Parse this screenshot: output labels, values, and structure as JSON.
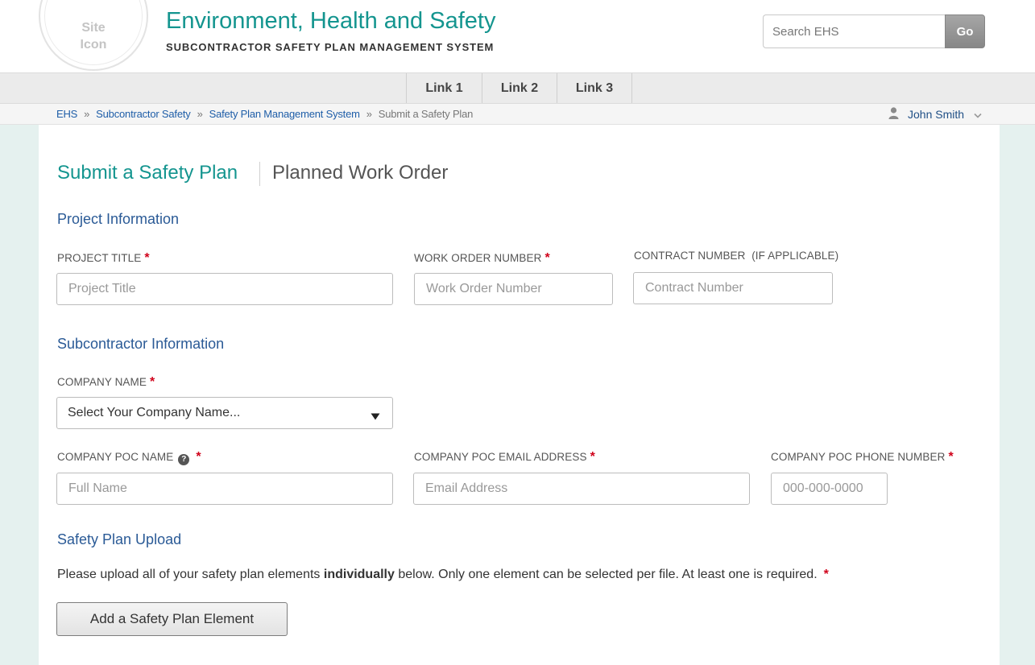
{
  "header": {
    "site_icon_text": "Site\nIcon",
    "title": "Environment, Health and Safety",
    "subtitle": "SUBCONTRACTOR SAFETY PLAN MANAGEMENT SYSTEM",
    "search_placeholder": "Search EHS",
    "search_button": "Go"
  },
  "nav": {
    "links": [
      {
        "label": "Link 1"
      },
      {
        "label": "Link 2"
      },
      {
        "label": "Link 3"
      }
    ]
  },
  "breadcrumb": {
    "items": [
      "EHS",
      "Subcontractor Safety",
      "Safety Plan Management System"
    ],
    "separator": "»",
    "current": "Submit a Safety Plan"
  },
  "user": {
    "name": "John Smith",
    "icon": "user-icon"
  },
  "page": {
    "title": "Submit a Safety Plan",
    "subtitle": "Planned Work Order"
  },
  "sections": {
    "project": {
      "heading": "Project Information",
      "project_title_label": "PROJECT TITLE",
      "project_title_placeholder": "Project Title",
      "work_order_label": "WORK ORDER NUMBER",
      "work_order_placeholder": "Work Order Number",
      "contract_label": "CONTRACT NUMBER  (IF APPLICABLE)",
      "contract_placeholder": "Contract Number"
    },
    "subcontractor": {
      "heading": "Subcontractor Information",
      "company_label": "COMPANY NAME",
      "company_selected": "Select Your Company Name...",
      "poc_name_label": "COMPANY POC NAME",
      "poc_name_placeholder": "Full Name",
      "poc_email_label": "COMPANY POC EMAIL ADDRESS",
      "poc_email_placeholder": "Email Address",
      "poc_phone_label": "COMPANY POC PHONE NUMBER",
      "poc_phone_placeholder": "000-000-0000"
    },
    "upload": {
      "heading": "Safety Plan Upload",
      "instructions_before": "Please upload all of your safety plan elements ",
      "instructions_bold": "individually",
      "instructions_after": " below. Only one element can be selected per file. At least one is required.",
      "add_button": "Add a Safety Plan Element"
    }
  },
  "required_marker": "*",
  "help_marker": "?",
  "colors": {
    "accent_teal": "#14958f",
    "heading_blue": "#2a5a96",
    "link_blue": "#1f5ea8",
    "required_red": "#d0021b",
    "page_background": "#e5f1ef"
  }
}
